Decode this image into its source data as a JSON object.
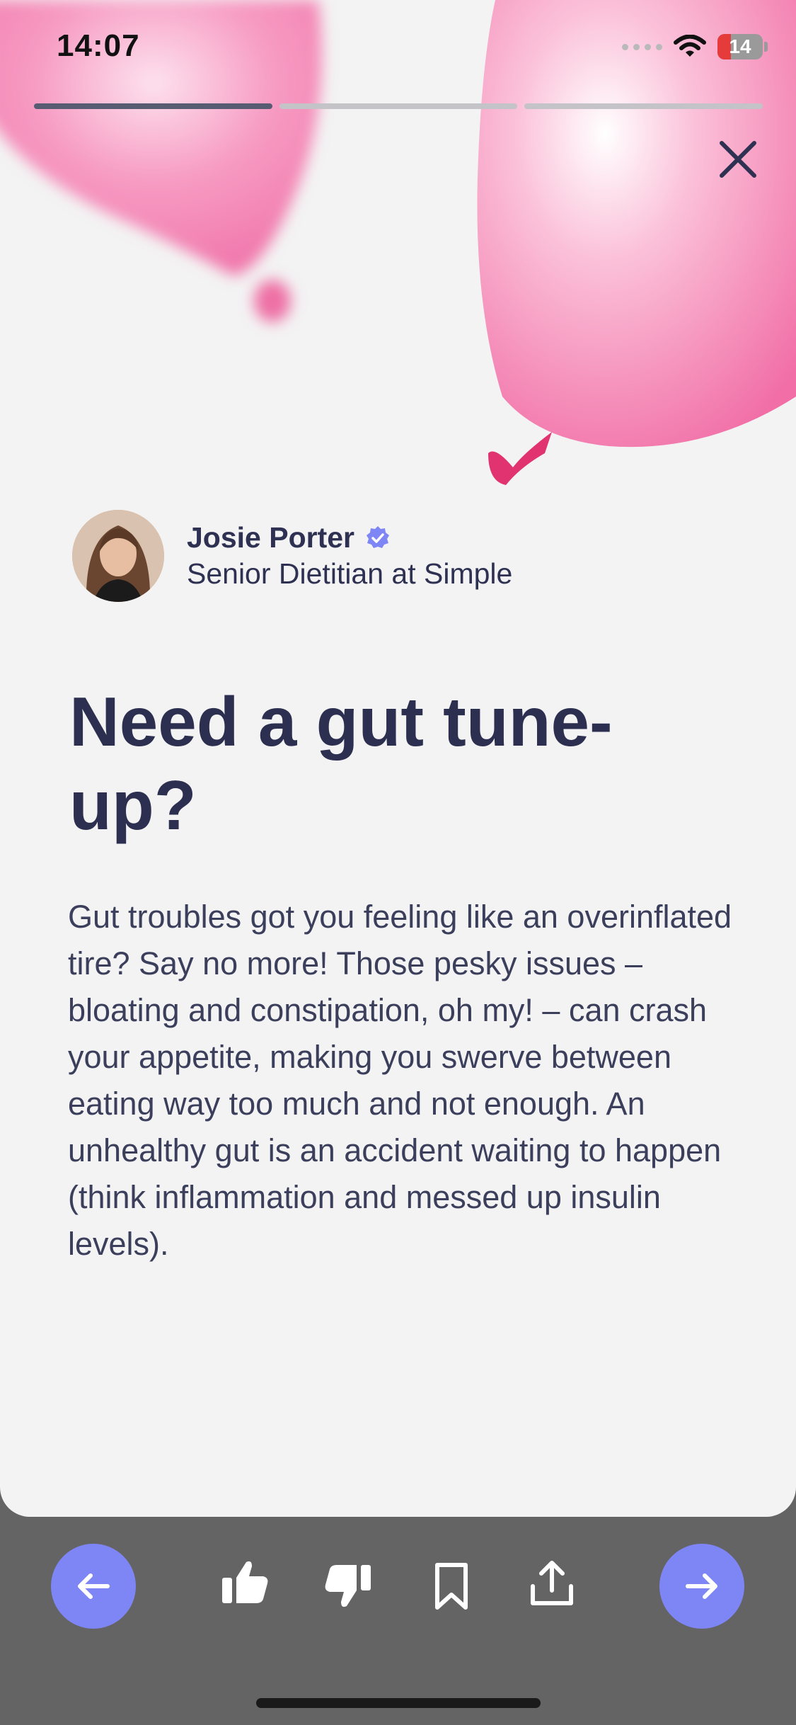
{
  "status_bar": {
    "time": "14:07",
    "battery_level": "14"
  },
  "story_progress": {
    "segments": 3,
    "active_index": 0
  },
  "author": {
    "name": "Josie Porter",
    "title": "Senior Dietitian at Simple",
    "verified": true
  },
  "article": {
    "headline": "Need a gut tune-up?",
    "body": "Gut troubles got you feeling like an overinflated tire? Say no more! Those pesky issues – bloating and constipation, oh my! – can crash your appetite, making you swerve between eating way too much and not enough. An unhealthy gut is an accident waiting to happen (think inflammation and messed up insulin levels)."
  },
  "toolbar": {
    "icons": [
      "arrow-left-icon",
      "thumbs-up-icon",
      "thumbs-down-icon",
      "bookmark-icon",
      "share-icon",
      "arrow-right-icon"
    ]
  },
  "colors": {
    "accent": "#7e85f5",
    "heading": "#2c2f4f",
    "card_background": "#f3f3f3",
    "toolbar_background": "#646464",
    "balloon": "#f37fae"
  }
}
